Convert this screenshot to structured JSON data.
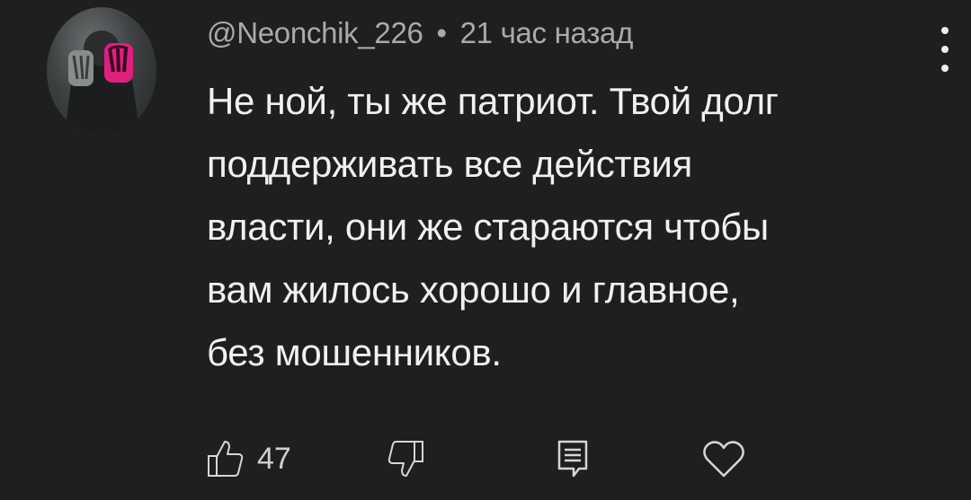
{
  "comment": {
    "author": "@Neonchik_226",
    "separator": "•",
    "time": "21 час назад",
    "text_lines": [
      "Не ной, ты же патриот. Твой долг",
      "поддерживать все действия",
      "власти, они же стараются чтобы",
      "вам жилось хорошо и главное,",
      "без мошенников."
    ]
  },
  "actions": {
    "like_count": "47"
  },
  "icons": {
    "avatar": "avatar-image",
    "more": "more-vertical-icon",
    "like": "thumb-up-icon",
    "dislike": "thumb-down-icon",
    "reply": "reply-icon",
    "heart": "heart-icon"
  },
  "colors": {
    "background": "#1f1f1f",
    "text": "#f1f1f1",
    "meta": "#aaaaaa",
    "icon_accent": "#e0207f"
  }
}
